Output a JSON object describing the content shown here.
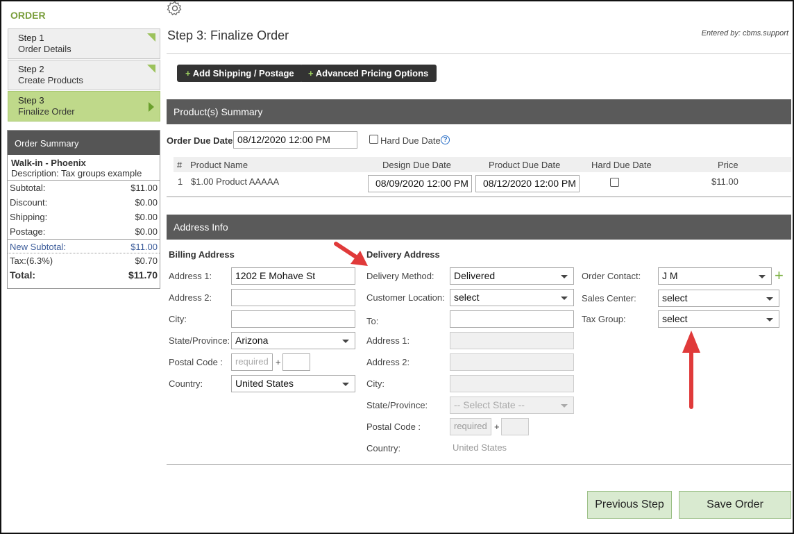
{
  "sidebar": {
    "title": "ORDER",
    "steps": [
      {
        "num": "Step 1",
        "label": "Order Details"
      },
      {
        "num": "Step 2",
        "label": "Create Products"
      },
      {
        "num": "Step 3",
        "label": "Finalize Order"
      }
    ],
    "summary": {
      "header": "Order Summary",
      "customer": "Walk-in - Phoenix",
      "description": "Description:  Tax groups example",
      "rows": [
        {
          "label": "Subtotal:",
          "value": "$11.00"
        },
        {
          "label": "Discount:",
          "value": "$0.00"
        },
        {
          "label": "Shipping:",
          "value": "$0.00"
        },
        {
          "label": "Postage:",
          "value": "$0.00"
        },
        {
          "label": "New Subtotal:",
          "value": "$11.00"
        },
        {
          "label": "Tax:(6.3%)",
          "value": "$0.70"
        },
        {
          "label": "Total:",
          "value": "$11.70"
        }
      ]
    }
  },
  "header": {
    "title": "Step 3: Finalize Order",
    "entered_by": "Entered by: cbms.support"
  },
  "toolbar": {
    "add_shipping": "Add Shipping / Postage",
    "advanced_pricing": "Advanced Pricing Options"
  },
  "products": {
    "section_title": "Product(s) Summary",
    "due_date_label": "Order Due Date:",
    "due_date_value": "08/12/2020 12:00 PM",
    "hard_due_label": "Hard Due Date",
    "columns": [
      "#",
      "Product Name",
      "Design Due Date",
      "Product Due Date",
      "Hard Due Date",
      "Price"
    ],
    "rows": [
      {
        "num": "1",
        "name": "$1.00 Product AAAAA",
        "design_due": "08/09/2020 12:00 PM",
        "product_due": "08/12/2020 12:00 PM",
        "price": "$11.00"
      }
    ]
  },
  "address": {
    "section_title": "Address Info",
    "billing": {
      "title": "Billing Address",
      "address1_label": "Address 1:",
      "address1": "1202 E Mohave St",
      "address2_label": "Address 2:",
      "city_label": "City:",
      "state_label": "State/Province:",
      "state": "Arizona",
      "postal_label": "Postal Code :",
      "postal_placeholder": "required",
      "country_label": "Country:",
      "country": "United States"
    },
    "delivery": {
      "title": "Delivery Address",
      "method_label": "Delivery Method:",
      "method": "Delivered",
      "location_label": "Customer Location:",
      "location": "select",
      "to_label": "To:",
      "address1_label": "Address 1:",
      "address2_label": "Address 2:",
      "city_label": "City:",
      "state_label": "State/Province:",
      "state": "-- Select State --",
      "postal_label": "Postal Code :",
      "postal_placeholder": "required",
      "country_label": "Country:",
      "country": "United States"
    },
    "other": {
      "contact_label": "Order Contact:",
      "contact": "J M",
      "sales_label": "Sales Center:",
      "sales": "select",
      "tax_label": "Tax Group:",
      "tax": "select"
    }
  },
  "footer": {
    "previous": "Previous Step",
    "save": "Save Order"
  },
  "colors": {
    "accent_green": "#7a9e3c",
    "section_gray": "#5a5a5a",
    "arrow_red": "#e03a3a"
  }
}
